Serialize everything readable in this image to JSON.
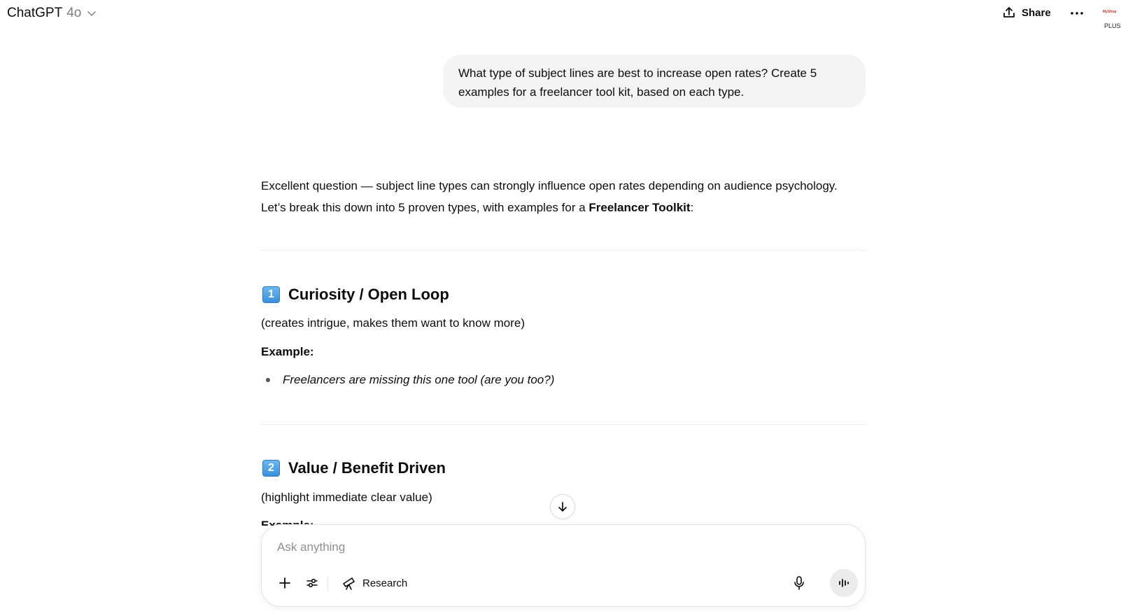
{
  "header": {
    "model_name": "ChatGPT",
    "model_version": "4o",
    "share_label": "Share",
    "plan_badge": "PLUS",
    "plan_logo_text": "MyShop"
  },
  "conversation": {
    "user_message": "What type of subject lines are best to increase open rates? Create 5 examples for a freelancer tool kit, based on each type.",
    "assistant": {
      "intro_part1": "Excellent question — subject line types can strongly influence open rates depending on audience psychology. Let’s break this down into 5 proven types, with examples for a ",
      "intro_bold": "Freelancer Toolkit",
      "intro_end": ":",
      "sections": [
        {
          "number": "1",
          "title": "Curiosity / Open Loop",
          "description": "(creates intrigue, makes them want to know more)",
          "example_label": "Example:",
          "examples": [
            "Freelancers are missing this one tool (are you too?)"
          ]
        },
        {
          "number": "2",
          "title": "Value / Benefit Driven",
          "description": "(highlight immediate clear value)",
          "example_label": "Example:"
        }
      ]
    }
  },
  "composer": {
    "placeholder": "Ask anything",
    "research_label": "Research"
  },
  "icons": {
    "chevron": "chevron-down-icon",
    "share": "share-icon",
    "more": "more-horizontal-icon",
    "scroll": "arrow-down-icon",
    "add": "plus-icon",
    "tools": "sliders-icon",
    "research": "telescope-icon",
    "mic": "microphone-icon",
    "voice": "voice-wave-icon"
  }
}
